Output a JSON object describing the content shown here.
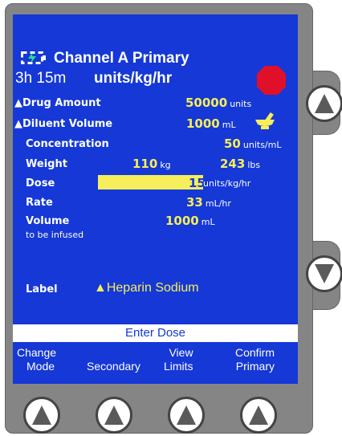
{
  "header": {
    "channel_title": "Channel A Primary",
    "time_remaining": "3h 15m",
    "dose_units": "units/kg/hr"
  },
  "rows": {
    "drug_amount": {
      "label": "▲Drug Amount",
      "value": "50000",
      "unit": "units"
    },
    "diluent_volume": {
      "label": "▲Diluent Volume",
      "value": "1000",
      "unit": "mL"
    },
    "concentration": {
      "label": "Concentration",
      "value": "50",
      "unit": "units/mL"
    },
    "weight": {
      "label": "Weight",
      "value_kg": "110",
      "unit_kg": "kg",
      "value_lbs": "243",
      "unit_lbs": "lbs"
    },
    "dose": {
      "label": "Dose",
      "value": "15",
      "unit": "units/kg/hr"
    },
    "rate": {
      "label": "Rate",
      "value": "33",
      "unit": "mL/hr"
    },
    "volume": {
      "label": "Volume",
      "sublabel": "to be infused",
      "value": "1000",
      "unit": "mL"
    }
  },
  "drug_label": {
    "label": "Label",
    "value": "▲Heparin Sodium"
  },
  "prompt": "Enter Dose",
  "softkeys": {
    "change_mode": {
      "line1": "Change",
      "line2": "Mode"
    },
    "secondary": {
      "line1": "",
      "line2": "Secondary"
    },
    "view_limits": {
      "line1": "View",
      "line2": "Limits"
    },
    "confirm_primary": {
      "line1": "Confirm",
      "line2": "Primary"
    }
  },
  "colors": {
    "screen": "#1538d6",
    "highlight": "#f6ee5a",
    "stop": "#e0102a",
    "bezel": "#858585"
  }
}
